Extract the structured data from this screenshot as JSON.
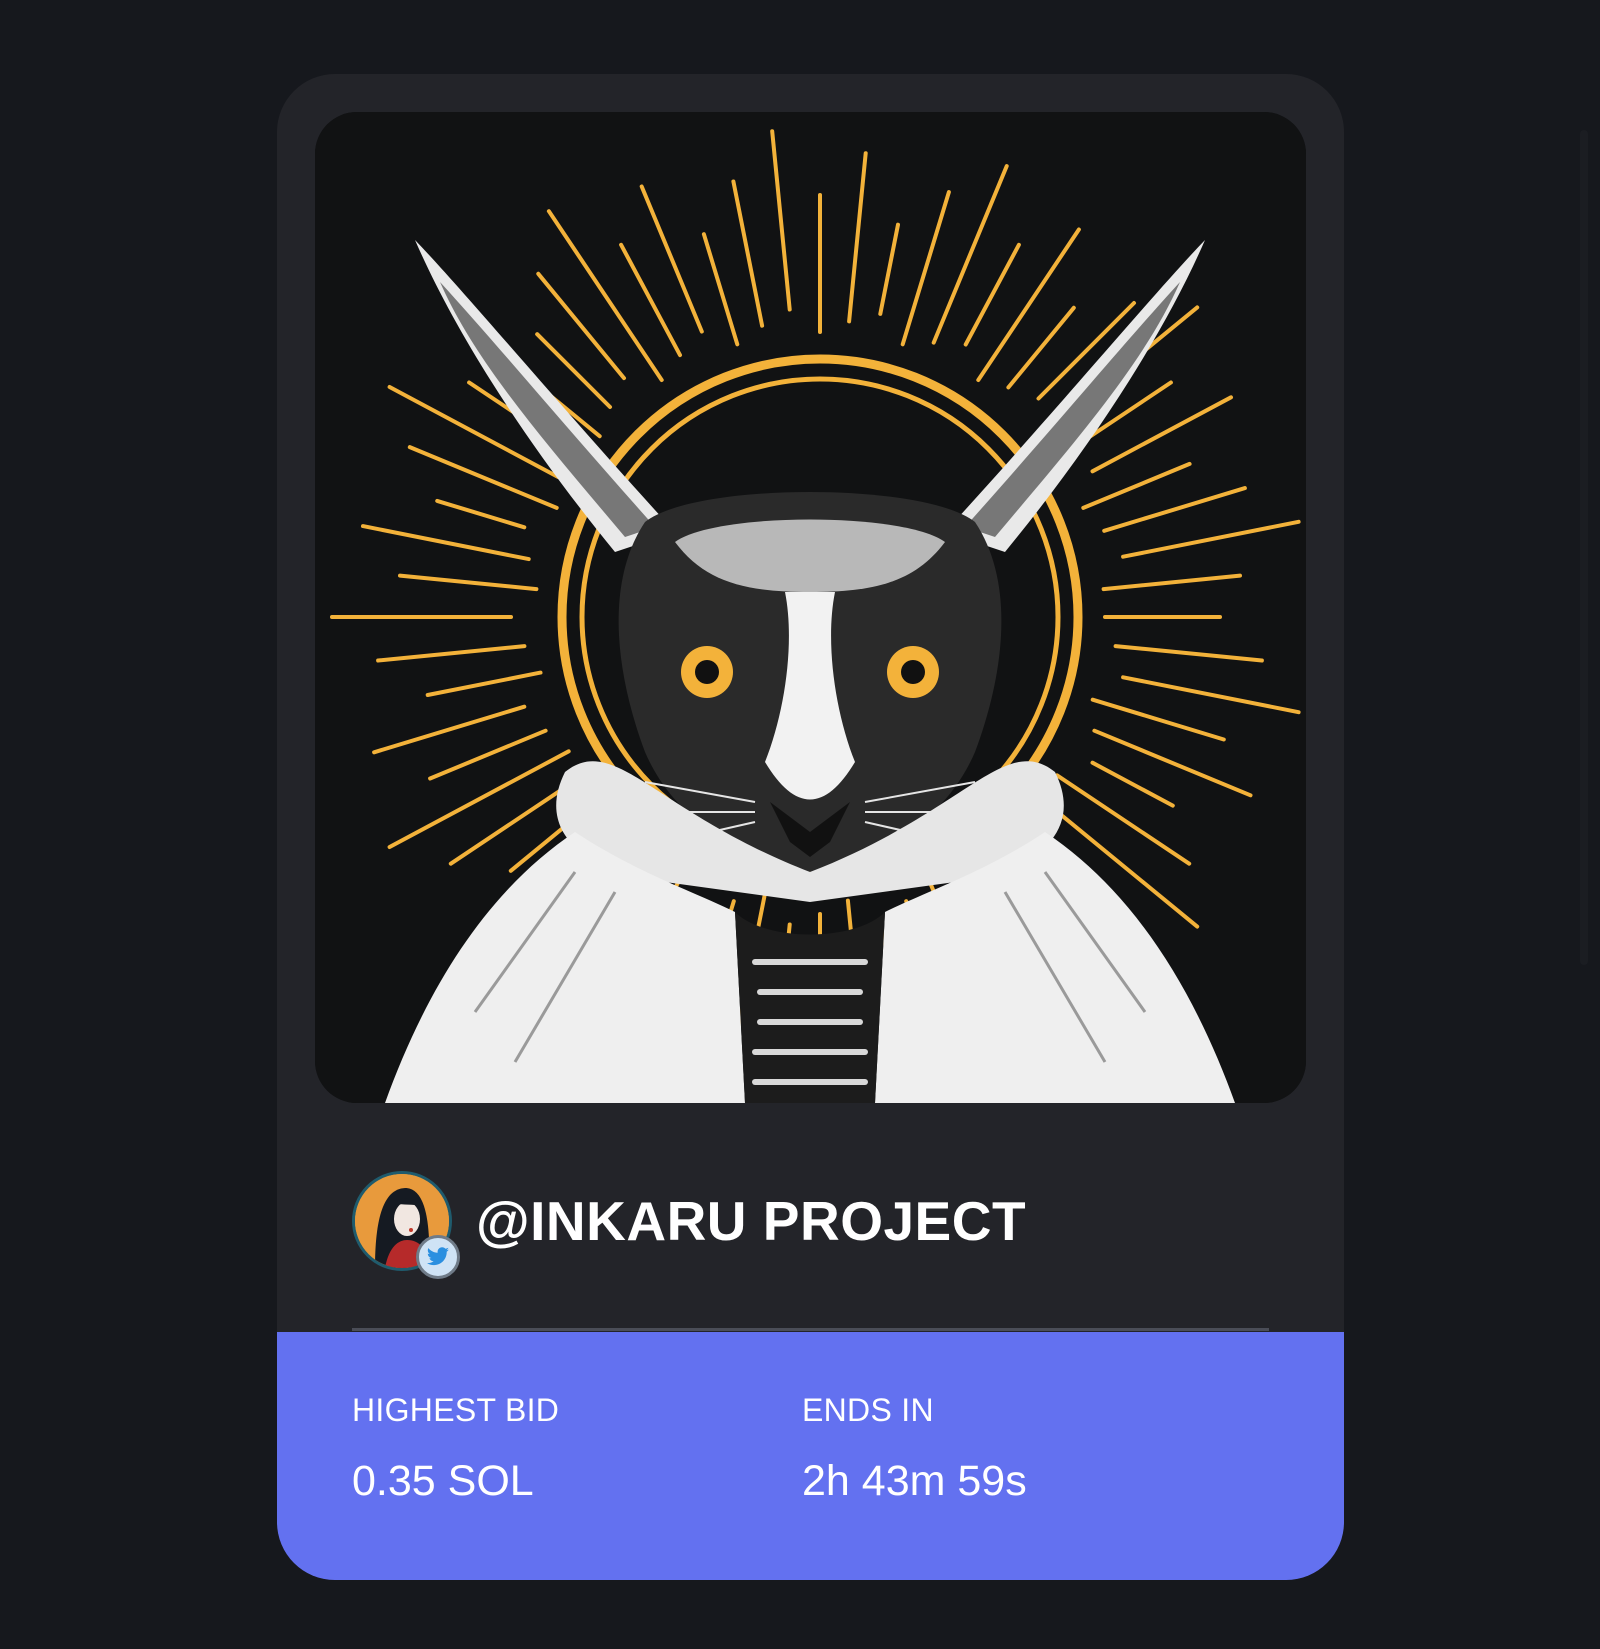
{
  "creator": {
    "handle": "@INKARU PROJECT",
    "avatar_icon": "artist-avatar",
    "verified_icon": "twitter-bird-icon"
  },
  "artwork": {
    "subject": "rabbit-illustration"
  },
  "auction": {
    "highest_bid_label": "HIGHEST BID",
    "highest_bid_value": "0.35 SOL",
    "ends_in_label": "ENDS IN",
    "ends_in_value": "2h 43m 59s"
  },
  "colors": {
    "page_bg": "#16181d",
    "card_bg": "#232429",
    "panel_bg": "#6371f0",
    "halo": "#f3b23a",
    "text": "#ffffff"
  }
}
